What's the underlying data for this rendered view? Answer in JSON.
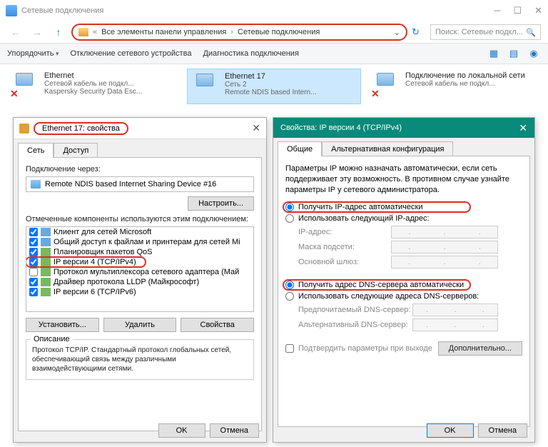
{
  "window": {
    "title": "Сетевые подключения",
    "breadcrumb": {
      "part1": "Все элементы панели управления",
      "part2": "Сетевые подключения"
    },
    "search_placeholder": "Поиск: Сетевые подкл..."
  },
  "toolbar": {
    "organize": "Упорядочить",
    "disable": "Отключение сетевого устройства",
    "diagnose": "Диагностика подключения"
  },
  "connections": [
    {
      "name": "Ethernet",
      "line1": "Сетевой кабель не подкл...",
      "line2": "Kaspersky Security Data Esc...",
      "x": true
    },
    {
      "name": "Ethernet 17",
      "line1": "Сеть 2",
      "line2": "Remote NDIS based Intern...",
      "x": false,
      "selected": true
    },
    {
      "name": "Подключение по локальной сети",
      "line1": "Сетевой кабель не подкл...",
      "line2": "",
      "x": true
    }
  ],
  "props": {
    "title": "Ethernet 17: свойства",
    "tabs": {
      "net": "Сеть",
      "access": "Доступ"
    },
    "connect_via": "Подключение через:",
    "adapter": "Remote NDIS based Internet Sharing Device #16",
    "configure": "Настроить...",
    "components_label": "Отмеченные компоненты используются этим подключением:",
    "components": [
      "Клиент для сетей Microsoft",
      "Общий доступ к файлам и принтерам для сетей Mi",
      "Планировщик пакетов QoS",
      "IP версии 4 (TCP/IPv4)",
      "Протокол мультиплексора сетевого адаптера (Май",
      "Драйвер протокола LLDP (Майкрософт)",
      "IP версии 6 (TCP/IPv6)"
    ],
    "install": "Установить...",
    "remove": "Удалить",
    "properties": "Свойства",
    "desc_title": "Описание",
    "desc": "Протокол TCP/IP. Стандартный протокол глобальных сетей, обеспечивающий связь между различными взаимодействующими сетями.",
    "ok": "OK",
    "cancel": "Отмена"
  },
  "ipv4": {
    "title": "Свойства: IP версии 4 (TCP/IPv4)",
    "tabs": {
      "general": "Общие",
      "alt": "Альтернативная конфигурация"
    },
    "info": "Параметры IP можно назначать автоматически, если сеть поддерживает эту возможность. В противном случае узнайте параметры IP у сетевого администратора.",
    "auto_ip": "Получить IP-адрес автоматически",
    "manual_ip": "Использовать следующий IP-адрес:",
    "ip_label": "IP-адрес:",
    "mask_label": "Маска подсети:",
    "gw_label": "Основной шлюз:",
    "auto_dns": "Получить адрес DNS-сервера автоматически",
    "manual_dns": "Использовать следующие адреса DNS-серверов:",
    "dns1": "Предпочитаемый DNS-сервер:",
    "dns2": "Альтернативный DNS-сервер:",
    "confirm": "Подтвердить параметры при выходе",
    "advanced": "Дополнительно...",
    "ok": "OK",
    "cancel": "Отмена"
  }
}
